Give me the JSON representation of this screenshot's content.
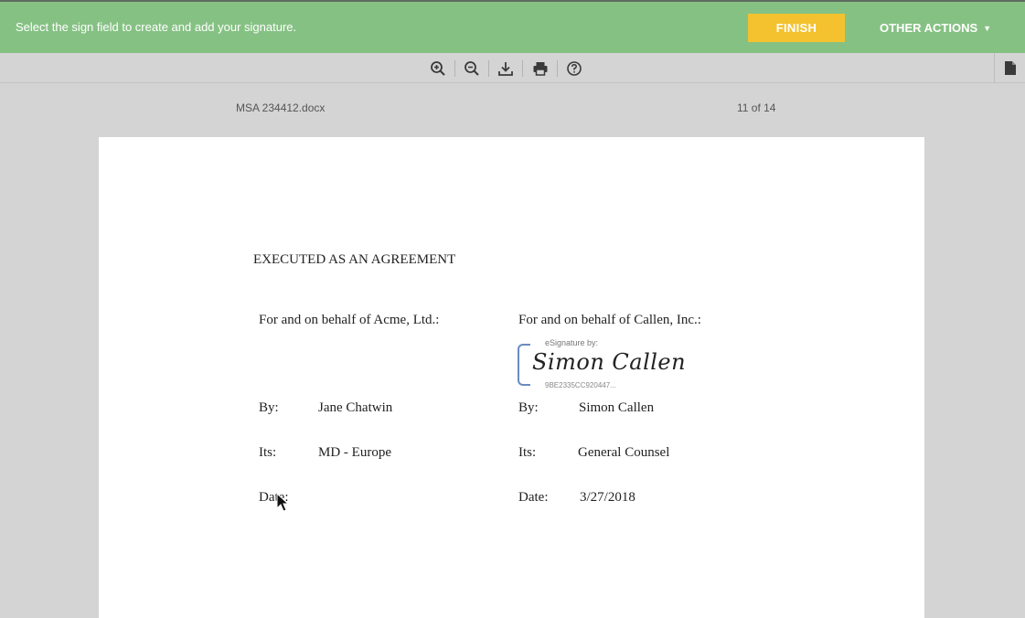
{
  "topbar": {
    "message": "Select the sign field to create and add your signature.",
    "finish_label": "FINISH",
    "other_actions_label": "OTHER ACTIONS",
    "caret": "▼"
  },
  "toolbar": {
    "icons": [
      "zoom-in-icon",
      "zoom-out-icon",
      "download-icon",
      "print-icon",
      "help-icon",
      "file-icon"
    ]
  },
  "document": {
    "name": "MSA 234412.docx",
    "page_indicator": "11 of 14",
    "heading": "EXECUTED AS AN AGREEMENT",
    "left": {
      "behalf": "For and on behalf of Acme, Ltd.:",
      "by_label": "By:",
      "by_value": "Jane Chatwin",
      "its_label": "Its:",
      "its_value": "MD - Europe",
      "date_label": "Date:",
      "date_value": ""
    },
    "right": {
      "behalf": "For and on behalf of Callen, Inc.:",
      "signature_label": "eSignature by:",
      "signature_name": "Simon Callen",
      "signature_hash": "9BE2335CC920447...",
      "by_label": "By:",
      "by_value": "Simon Callen",
      "its_label": "Its:",
      "its_value": "General Counsel",
      "date_label": "Date:",
      "date_value": "3/27/2018"
    }
  },
  "colors": {
    "topbar": "#86c184",
    "finish": "#f4c22e",
    "signature_frame": "#6a8bc1"
  }
}
